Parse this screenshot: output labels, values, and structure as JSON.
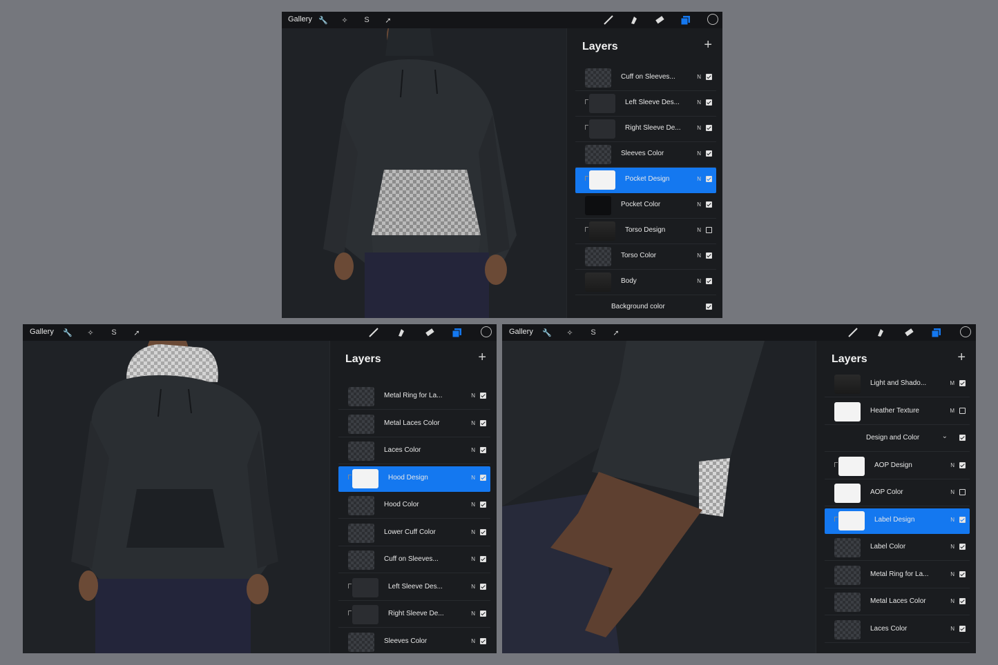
{
  "screens": [
    {
      "gallery": "Gallery",
      "panel_title": "Layers",
      "layers": [
        {
          "name": "Cuff on Sleeves...",
          "mode": "N",
          "visible": true,
          "thumb": "checker",
          "clipped": false
        },
        {
          "name": "Left Sleeve Des...",
          "mode": "N",
          "visible": true,
          "thumb": "solid",
          "clipped": true
        },
        {
          "name": "Right Sleeve De...",
          "mode": "N",
          "visible": true,
          "thumb": "solid",
          "clipped": true
        },
        {
          "name": "Sleeves Color",
          "mode": "N",
          "visible": true,
          "thumb": "checker",
          "clipped": false
        },
        {
          "name": "Pocket Design",
          "mode": "N",
          "visible": true,
          "thumb": "white",
          "clipped": true,
          "selected": true
        },
        {
          "name": "Pocket Color",
          "mode": "N",
          "visible": true,
          "thumb": "black",
          "clipped": false
        },
        {
          "name": "Torso Design",
          "mode": "N",
          "visible": false,
          "thumb": "photo",
          "clipped": true
        },
        {
          "name": "Torso Color",
          "mode": "N",
          "visible": true,
          "thumb": "checker",
          "clipped": false
        },
        {
          "name": "Body",
          "mode": "N",
          "visible": true,
          "thumb": "photo",
          "clipped": false
        },
        {
          "name": "Background color",
          "mode": "",
          "visible": true,
          "thumb": "none",
          "clipped": false
        }
      ]
    },
    {
      "gallery": "Gallery",
      "panel_title": "Layers",
      "layers": [
        {
          "name": "Metal Ring for La...",
          "mode": "N",
          "visible": true,
          "thumb": "checker",
          "clipped": false
        },
        {
          "name": "Metal Laces Color",
          "mode": "N",
          "visible": true,
          "thumb": "checker",
          "clipped": false
        },
        {
          "name": "Laces Color",
          "mode": "N",
          "visible": true,
          "thumb": "checker",
          "clipped": false
        },
        {
          "name": "Hood Design",
          "mode": "N",
          "visible": true,
          "thumb": "white",
          "clipped": true,
          "selected": true
        },
        {
          "name": "Hood Color",
          "mode": "N",
          "visible": true,
          "thumb": "checker",
          "clipped": false
        },
        {
          "name": "Lower Cuff Color",
          "mode": "N",
          "visible": true,
          "thumb": "checker",
          "clipped": false
        },
        {
          "name": "Cuff on Sleeves...",
          "mode": "N",
          "visible": true,
          "thumb": "checker",
          "clipped": false
        },
        {
          "name": "Left Sleeve Des...",
          "mode": "N",
          "visible": true,
          "thumb": "solid",
          "clipped": true
        },
        {
          "name": "Right Sleeve De...",
          "mode": "N",
          "visible": true,
          "thumb": "solid",
          "clipped": true
        },
        {
          "name": "Sleeves Color",
          "mode": "N",
          "visible": true,
          "thumb": "checker",
          "clipped": false
        }
      ]
    },
    {
      "gallery": "Gallery",
      "panel_title": "Layers",
      "layers": [
        {
          "name": "Light and Shado...",
          "mode": "M",
          "visible": true,
          "thumb": "photo",
          "clipped": false
        },
        {
          "name": "Heather Texture",
          "mode": "M",
          "visible": false,
          "thumb": "white",
          "clipped": false
        },
        {
          "name": "Design and Color",
          "mode": "",
          "visible": true,
          "thumb": "none",
          "clipped": false,
          "group": true
        },
        {
          "name": "AOP  Design",
          "mode": "N",
          "visible": true,
          "thumb": "white",
          "clipped": true
        },
        {
          "name": "AOP Color",
          "mode": "N",
          "visible": false,
          "thumb": "white",
          "clipped": false
        },
        {
          "name": "Label Design",
          "mode": "N",
          "visible": true,
          "thumb": "white",
          "clipped": true,
          "selected": true
        },
        {
          "name": "Label Color",
          "mode": "N",
          "visible": true,
          "thumb": "checker",
          "clipped": false
        },
        {
          "name": "Metal Ring for La...",
          "mode": "N",
          "visible": true,
          "thumb": "checker",
          "clipped": false
        },
        {
          "name": "Metal Laces Color",
          "mode": "N",
          "visible": true,
          "thumb": "checker",
          "clipped": false
        },
        {
          "name": "Laces Color",
          "mode": "N",
          "visible": true,
          "thumb": "checker",
          "clipped": false
        }
      ]
    }
  ],
  "colors": {
    "accent": "#1478f0",
    "background": "#75777d",
    "canvas": "#1f2226"
  }
}
